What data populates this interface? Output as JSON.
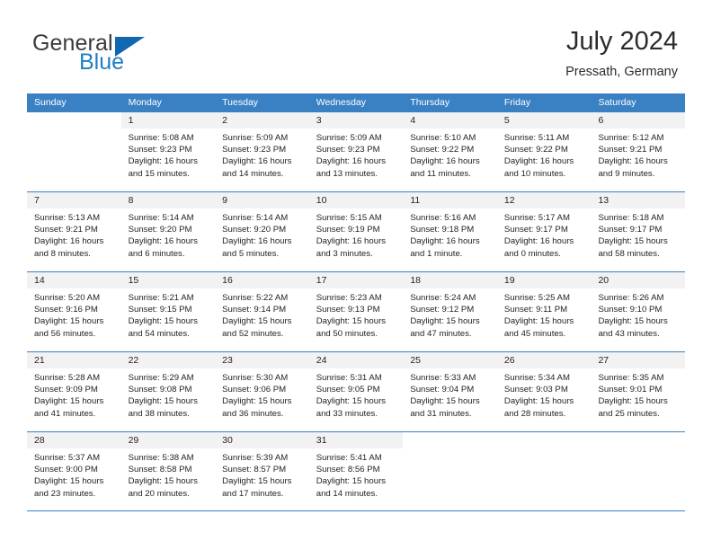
{
  "brand": {
    "word_one": "General",
    "word_two": "Blue",
    "triangle_color": "#1167b1",
    "blue_color": "#1f7fc4",
    "gray_color": "#3a3a3a"
  },
  "header": {
    "title": "July 2024",
    "subtitle": "Pressath, Germany"
  },
  "theme": {
    "header_bg": "#3a81c4",
    "day_number_bg": "#f2f2f2",
    "text_color": "#231f20"
  },
  "labels": {
    "sunrise_prefix": "Sunrise:",
    "sunset_prefix": "Sunset:",
    "daylight_prefix": "Daylight:"
  },
  "weekdays": [
    "Sunday",
    "Monday",
    "Tuesday",
    "Wednesday",
    "Thursday",
    "Friday",
    "Saturday"
  ],
  "weeks": [
    [
      {
        "day": "",
        "sunrise": "",
        "sunset": "",
        "daylight_line1": "",
        "daylight_line2": ""
      },
      {
        "day": "1",
        "sunrise": "Sunrise: 5:08 AM",
        "sunset": "Sunset: 9:23 PM",
        "daylight_line1": "Daylight: 16 hours",
        "daylight_line2": "and 15 minutes."
      },
      {
        "day": "2",
        "sunrise": "Sunrise: 5:09 AM",
        "sunset": "Sunset: 9:23 PM",
        "daylight_line1": "Daylight: 16 hours",
        "daylight_line2": "and 14 minutes."
      },
      {
        "day": "3",
        "sunrise": "Sunrise: 5:09 AM",
        "sunset": "Sunset: 9:23 PM",
        "daylight_line1": "Daylight: 16 hours",
        "daylight_line2": "and 13 minutes."
      },
      {
        "day": "4",
        "sunrise": "Sunrise: 5:10 AM",
        "sunset": "Sunset: 9:22 PM",
        "daylight_line1": "Daylight: 16 hours",
        "daylight_line2": "and 11 minutes."
      },
      {
        "day": "5",
        "sunrise": "Sunrise: 5:11 AM",
        "sunset": "Sunset: 9:22 PM",
        "daylight_line1": "Daylight: 16 hours",
        "daylight_line2": "and 10 minutes."
      },
      {
        "day": "6",
        "sunrise": "Sunrise: 5:12 AM",
        "sunset": "Sunset: 9:21 PM",
        "daylight_line1": "Daylight: 16 hours",
        "daylight_line2": "and 9 minutes."
      }
    ],
    [
      {
        "day": "7",
        "sunrise": "Sunrise: 5:13 AM",
        "sunset": "Sunset: 9:21 PM",
        "daylight_line1": "Daylight: 16 hours",
        "daylight_line2": "and 8 minutes."
      },
      {
        "day": "8",
        "sunrise": "Sunrise: 5:14 AM",
        "sunset": "Sunset: 9:20 PM",
        "daylight_line1": "Daylight: 16 hours",
        "daylight_line2": "and 6 minutes."
      },
      {
        "day": "9",
        "sunrise": "Sunrise: 5:14 AM",
        "sunset": "Sunset: 9:20 PM",
        "daylight_line1": "Daylight: 16 hours",
        "daylight_line2": "and 5 minutes."
      },
      {
        "day": "10",
        "sunrise": "Sunrise: 5:15 AM",
        "sunset": "Sunset: 9:19 PM",
        "daylight_line1": "Daylight: 16 hours",
        "daylight_line2": "and 3 minutes."
      },
      {
        "day": "11",
        "sunrise": "Sunrise: 5:16 AM",
        "sunset": "Sunset: 9:18 PM",
        "daylight_line1": "Daylight: 16 hours",
        "daylight_line2": "and 1 minute."
      },
      {
        "day": "12",
        "sunrise": "Sunrise: 5:17 AM",
        "sunset": "Sunset: 9:17 PM",
        "daylight_line1": "Daylight: 16 hours",
        "daylight_line2": "and 0 minutes."
      },
      {
        "day": "13",
        "sunrise": "Sunrise: 5:18 AM",
        "sunset": "Sunset: 9:17 PM",
        "daylight_line1": "Daylight: 15 hours",
        "daylight_line2": "and 58 minutes."
      }
    ],
    [
      {
        "day": "14",
        "sunrise": "Sunrise: 5:20 AM",
        "sunset": "Sunset: 9:16 PM",
        "daylight_line1": "Daylight: 15 hours",
        "daylight_line2": "and 56 minutes."
      },
      {
        "day": "15",
        "sunrise": "Sunrise: 5:21 AM",
        "sunset": "Sunset: 9:15 PM",
        "daylight_line1": "Daylight: 15 hours",
        "daylight_line2": "and 54 minutes."
      },
      {
        "day": "16",
        "sunrise": "Sunrise: 5:22 AM",
        "sunset": "Sunset: 9:14 PM",
        "daylight_line1": "Daylight: 15 hours",
        "daylight_line2": "and 52 minutes."
      },
      {
        "day": "17",
        "sunrise": "Sunrise: 5:23 AM",
        "sunset": "Sunset: 9:13 PM",
        "daylight_line1": "Daylight: 15 hours",
        "daylight_line2": "and 50 minutes."
      },
      {
        "day": "18",
        "sunrise": "Sunrise: 5:24 AM",
        "sunset": "Sunset: 9:12 PM",
        "daylight_line1": "Daylight: 15 hours",
        "daylight_line2": "and 47 minutes."
      },
      {
        "day": "19",
        "sunrise": "Sunrise: 5:25 AM",
        "sunset": "Sunset: 9:11 PM",
        "daylight_line1": "Daylight: 15 hours",
        "daylight_line2": "and 45 minutes."
      },
      {
        "day": "20",
        "sunrise": "Sunrise: 5:26 AM",
        "sunset": "Sunset: 9:10 PM",
        "daylight_line1": "Daylight: 15 hours",
        "daylight_line2": "and 43 minutes."
      }
    ],
    [
      {
        "day": "21",
        "sunrise": "Sunrise: 5:28 AM",
        "sunset": "Sunset: 9:09 PM",
        "daylight_line1": "Daylight: 15 hours",
        "daylight_line2": "and 41 minutes."
      },
      {
        "day": "22",
        "sunrise": "Sunrise: 5:29 AM",
        "sunset": "Sunset: 9:08 PM",
        "daylight_line1": "Daylight: 15 hours",
        "daylight_line2": "and 38 minutes."
      },
      {
        "day": "23",
        "sunrise": "Sunrise: 5:30 AM",
        "sunset": "Sunset: 9:06 PM",
        "daylight_line1": "Daylight: 15 hours",
        "daylight_line2": "and 36 minutes."
      },
      {
        "day": "24",
        "sunrise": "Sunrise: 5:31 AM",
        "sunset": "Sunset: 9:05 PM",
        "daylight_line1": "Daylight: 15 hours",
        "daylight_line2": "and 33 minutes."
      },
      {
        "day": "25",
        "sunrise": "Sunrise: 5:33 AM",
        "sunset": "Sunset: 9:04 PM",
        "daylight_line1": "Daylight: 15 hours",
        "daylight_line2": "and 31 minutes."
      },
      {
        "day": "26",
        "sunrise": "Sunrise: 5:34 AM",
        "sunset": "Sunset: 9:03 PM",
        "daylight_line1": "Daylight: 15 hours",
        "daylight_line2": "and 28 minutes."
      },
      {
        "day": "27",
        "sunrise": "Sunrise: 5:35 AM",
        "sunset": "Sunset: 9:01 PM",
        "daylight_line1": "Daylight: 15 hours",
        "daylight_line2": "and 25 minutes."
      }
    ],
    [
      {
        "day": "28",
        "sunrise": "Sunrise: 5:37 AM",
        "sunset": "Sunset: 9:00 PM",
        "daylight_line1": "Daylight: 15 hours",
        "daylight_line2": "and 23 minutes."
      },
      {
        "day": "29",
        "sunrise": "Sunrise: 5:38 AM",
        "sunset": "Sunset: 8:58 PM",
        "daylight_line1": "Daylight: 15 hours",
        "daylight_line2": "and 20 minutes."
      },
      {
        "day": "30",
        "sunrise": "Sunrise: 5:39 AM",
        "sunset": "Sunset: 8:57 PM",
        "daylight_line1": "Daylight: 15 hours",
        "daylight_line2": "and 17 minutes."
      },
      {
        "day": "31",
        "sunrise": "Sunrise: 5:41 AM",
        "sunset": "Sunset: 8:56 PM",
        "daylight_line1": "Daylight: 15 hours",
        "daylight_line2": "and 14 minutes."
      },
      {
        "day": "",
        "sunrise": "",
        "sunset": "",
        "daylight_line1": "",
        "daylight_line2": ""
      },
      {
        "day": "",
        "sunrise": "",
        "sunset": "",
        "daylight_line1": "",
        "daylight_line2": ""
      },
      {
        "day": "",
        "sunrise": "",
        "sunset": "",
        "daylight_line1": "",
        "daylight_line2": ""
      }
    ]
  ]
}
